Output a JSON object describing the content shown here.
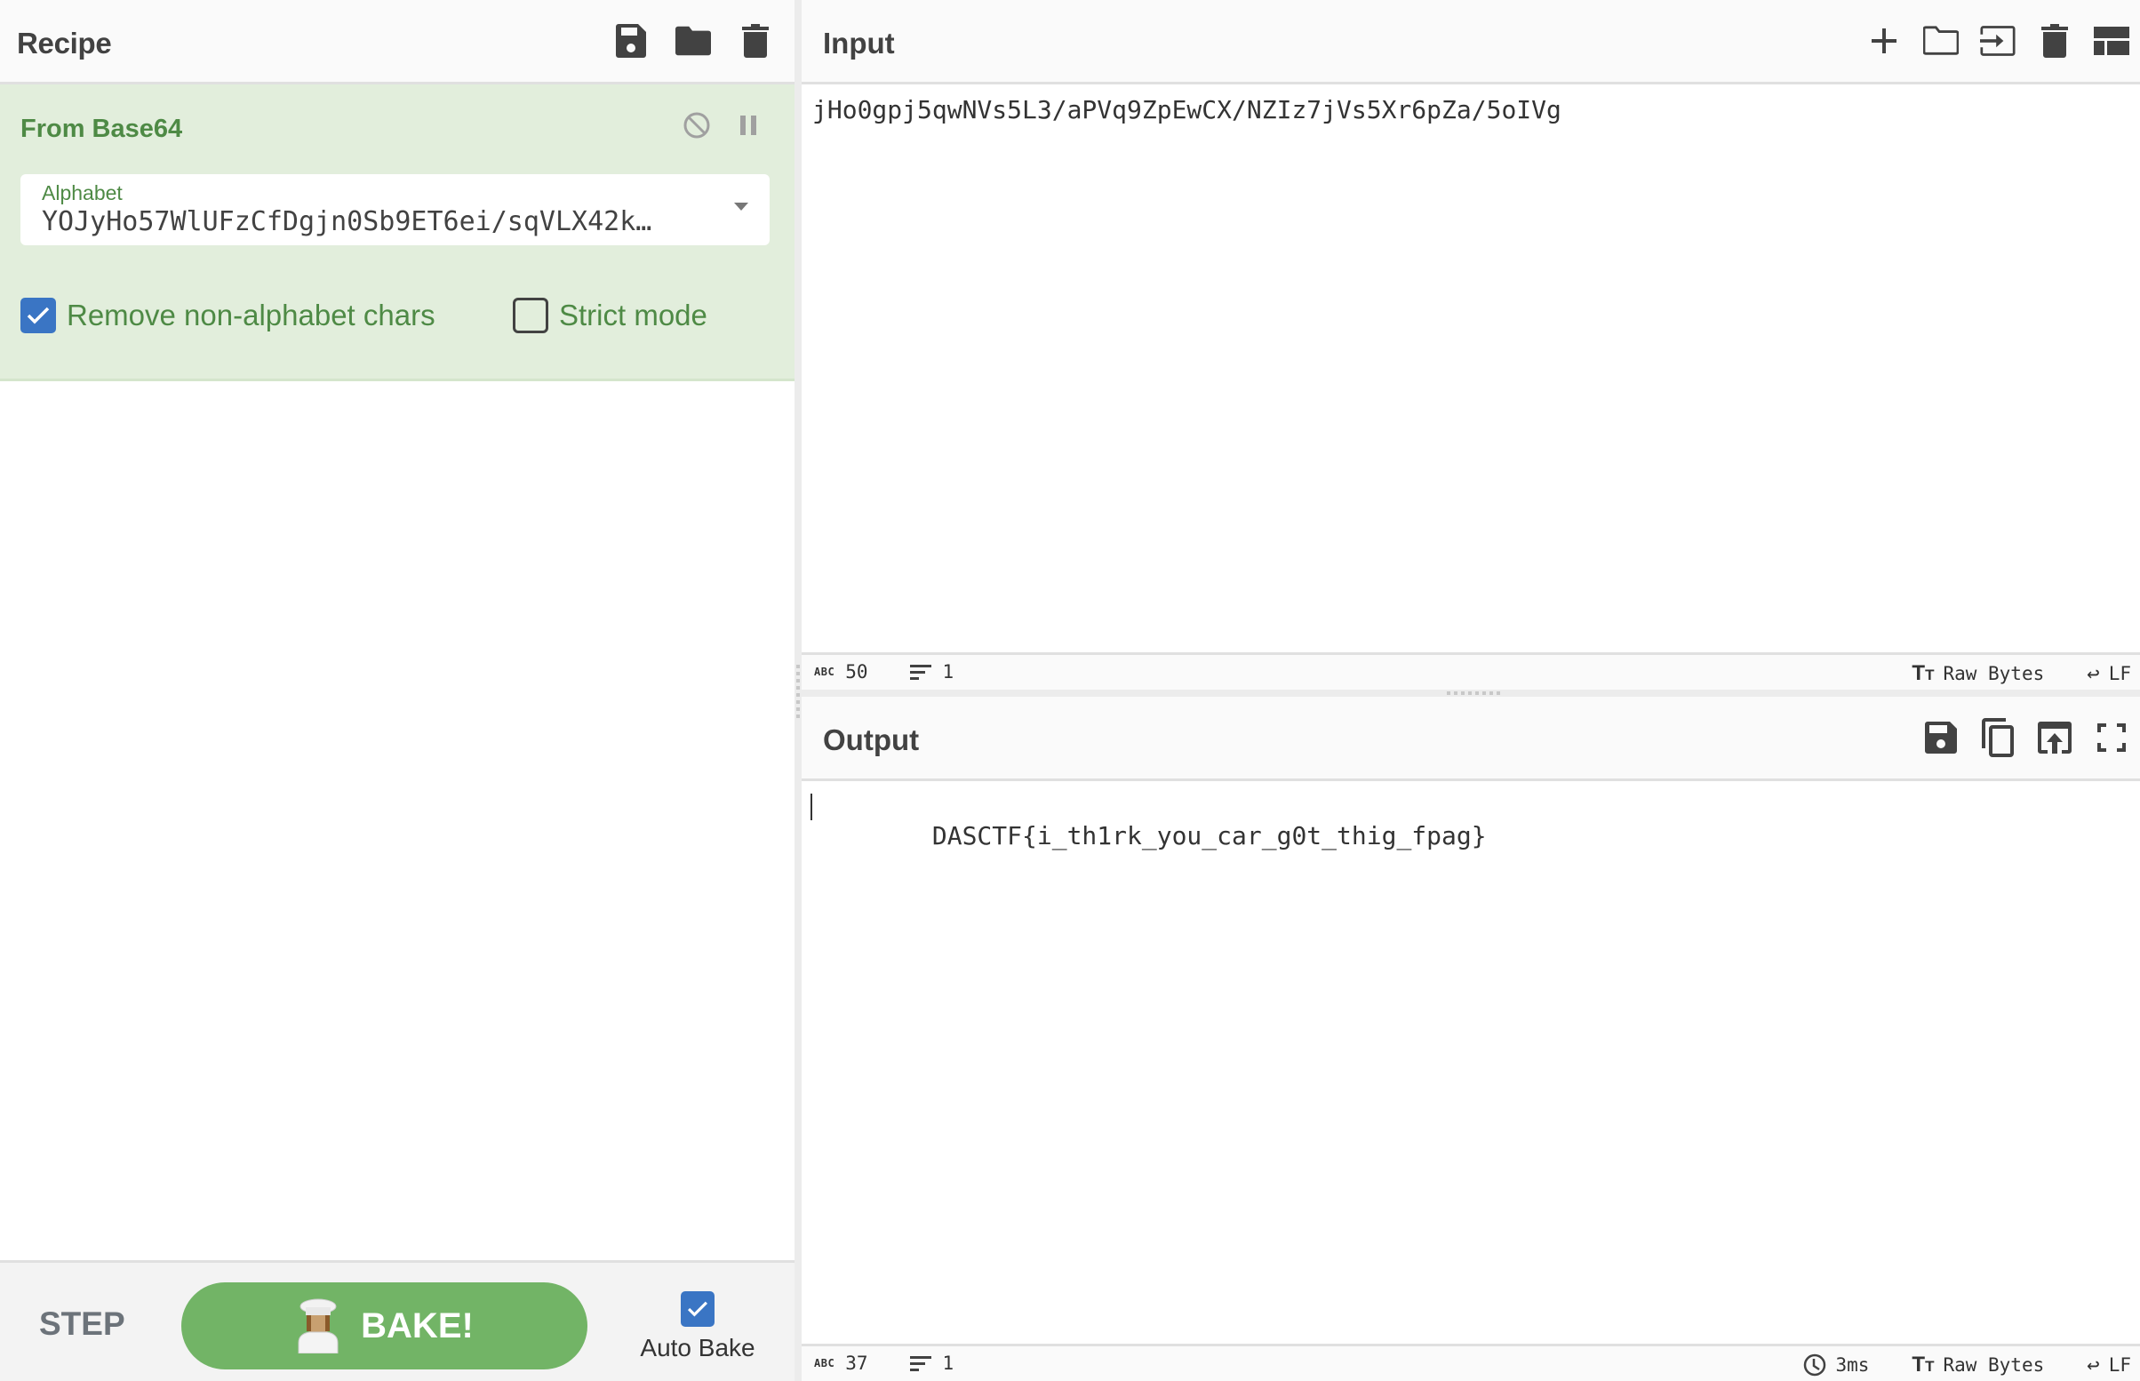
{
  "recipe": {
    "title": "Recipe",
    "header_icons": [
      "save-icon",
      "folder-icon",
      "trash-icon"
    ],
    "operation": {
      "name": "From Base64",
      "controls": [
        "disable-icon",
        "pause-icon"
      ],
      "alphabet": {
        "label": "Alphabet",
        "value": "YOJyHo57WlUFzCfDgjn0Sb9ET6ei/sqVLX42k…"
      },
      "remove_non_alphabet": {
        "label": "Remove non-alphabet chars",
        "checked": true
      },
      "strict_mode": {
        "label": "Strict mode",
        "checked": false
      }
    },
    "controls": {
      "step_label": "STEP",
      "bake_label": "BAKE!",
      "auto_bake_label": "Auto Bake",
      "auto_bake_checked": true
    }
  },
  "input": {
    "title": "Input",
    "header_icons": [
      "plus-icon",
      "folder-icon",
      "sign-in-icon",
      "trash-icon",
      "layout-icon"
    ],
    "text": "jHo0gpj5qwNVs5L3/aPVq9ZpEwCX/NZIz7jVs5Xr6pZa/5oIVg",
    "status": {
      "length": "50",
      "lines": "1",
      "encoding": "Raw Bytes",
      "eol": "LF"
    }
  },
  "output": {
    "title": "Output",
    "header_icons": [
      "save-icon",
      "copy-icon",
      "replace-input-icon",
      "fullscreen-icon"
    ],
    "text": "DASCTF{i_th1rk_you_car_g0t_thig_fpag}",
    "status": {
      "length": "37",
      "lines": "1",
      "time": "3ms",
      "encoding": "Raw Bytes",
      "eol": "LF"
    }
  },
  "colors": {
    "accent_green": "#72b466",
    "op_background": "#e2eedc",
    "op_text": "#4e8a45",
    "checkbox_blue": "#3a75c4"
  }
}
